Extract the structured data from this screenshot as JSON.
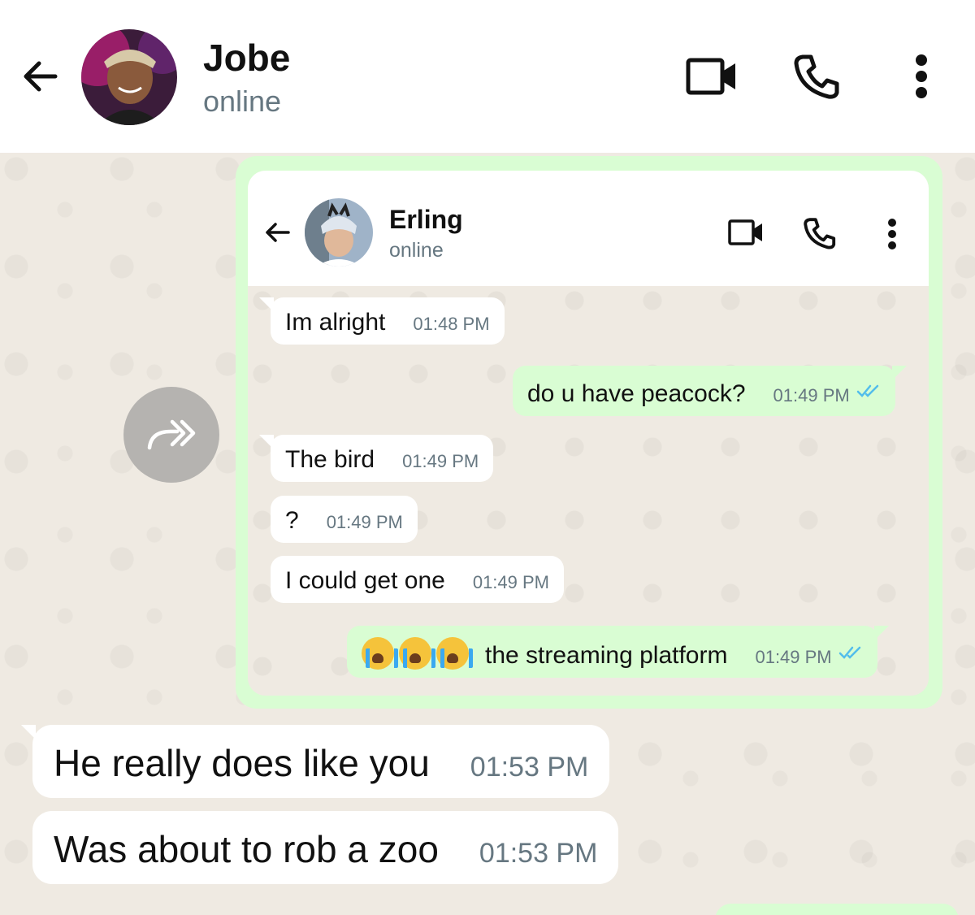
{
  "header": {
    "contact_name": "Jobe",
    "status": "online",
    "icons": [
      "back-arrow-icon",
      "video-call-icon",
      "phone-icon",
      "more-options-icon"
    ]
  },
  "forward_icon": "forward-icon",
  "forwarded_screenshot": {
    "header": {
      "contact_name": "Erling",
      "status": "online"
    },
    "messages": [
      {
        "text": "Im alright",
        "time": "01:48 PM",
        "direction": "incoming"
      },
      {
        "text": "do u have peacock?",
        "time": "01:49 PM",
        "direction": "outgoing"
      },
      {
        "text": "The bird",
        "time": "01:49 PM",
        "direction": "incoming"
      },
      {
        "text": "?",
        "time": "01:49 PM",
        "direction": "incoming"
      },
      {
        "text": "I could get one",
        "time": "01:49 PM",
        "direction": "incoming"
      },
      {
        "text": "the streaming platform",
        "time": "01:49 PM",
        "direction": "outgoing",
        "emoji": "😭😭😭"
      }
    ]
  },
  "messages": [
    {
      "text": "He really does like you",
      "time": "01:53 PM",
      "direction": "incoming"
    },
    {
      "text": "Was about to rob a zoo",
      "time": "01:53 PM",
      "direction": "incoming"
    }
  ],
  "colors": {
    "incoming_bubble": "#ffffff",
    "outgoing_bubble": "#d9fdd3",
    "chat_background": "#efeae2",
    "read_ticks": "#53bdeb",
    "timestamp": "#667781"
  }
}
